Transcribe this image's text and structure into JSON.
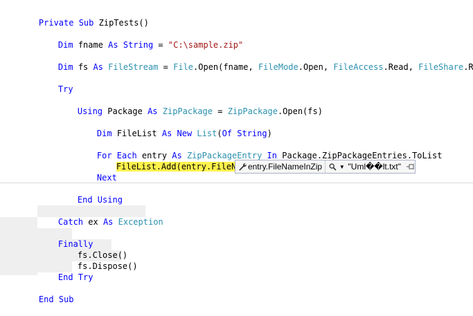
{
  "code": {
    "sub_header": {
      "kw": "Private Sub",
      "name": " ZipTests()"
    },
    "dim_fname": {
      "kw1": "Dim",
      "mid": " fname ",
      "kw2": "As",
      "type": " String",
      "eq": " = ",
      "value": "\"C:\\sample.zip\""
    },
    "dim_fs": {
      "kw1": "Dim",
      "mid": " fs ",
      "kw2": "As",
      "type1": " FileStream",
      "t1": " = ",
      "t2": "File",
      "t3": ".Open(fname, ",
      "t4": "FileMode",
      "t5": ".Open, ",
      "t6": "FileAccess",
      "t7": ".Read, ",
      "t8": "FileShare",
      "t9": ".Read)"
    },
    "try": "Try",
    "using": {
      "kw1": "Using",
      "mid": " Package ",
      "kw2": "As",
      "type1": " ZipPackage",
      "eq": " = ",
      "type2": "ZipPackage",
      "rest": ".Open(fs)"
    },
    "dim_filelist": {
      "kw1": "Dim",
      "mid": " FileList ",
      "kw2": "As",
      "kw3": " New",
      "type1": " List",
      "p1": "(",
      "kw4": "Of",
      "kw5": " String",
      "p2": ")"
    },
    "for_each": {
      "kw1": "For Each",
      "mid": " entry ",
      "kw2": "As",
      "type1": " ZipPackageEntry",
      "kw3": " In",
      "rest": " Package.ZipPackageEntries.ToList"
    },
    "add_line": "FileList.Add(entry.FileNameInZip)",
    "next": "Next",
    "end_using": "End Using",
    "catch": {
      "kw1": "Catch",
      "mid": " ex ",
      "kw2": "As",
      "type": " Exception"
    },
    "finally": "Finally",
    "close": "fs.Close()",
    "dispose": "fs.Dispose()",
    "end_try": "End Try",
    "end_sub": "End Sub"
  },
  "datatip": {
    "expression": "entry.FileNameInZip",
    "value": "\"Uml��lt.txt\"",
    "icons": [
      "wrench-icon",
      "magnifier-icon",
      "chevron-down-icon",
      "pin-icon"
    ]
  },
  "colors": {
    "keyword": "#0000ff",
    "type": "#2b91af",
    "string": "#a31515",
    "current_statement": "#fff24c"
  }
}
